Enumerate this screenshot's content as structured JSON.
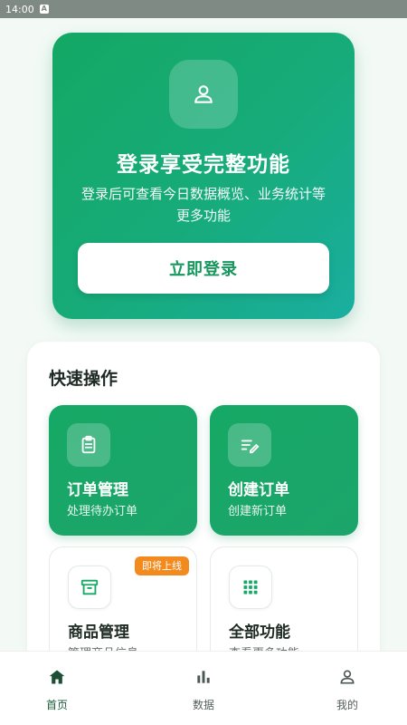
{
  "status_bar": {
    "time": "14:00",
    "badge": "A"
  },
  "login_card": {
    "title": "登录享受完整功能",
    "description": "登录后可查看今日数据概览、业务统计等更多功能",
    "button_label": "立即登录",
    "icon": "person-icon"
  },
  "quick_actions": {
    "title": "快速操作",
    "tiles": [
      {
        "title": "订单管理",
        "subtitle": "处理待办订单",
        "icon": "clipboard-icon",
        "style": "green"
      },
      {
        "title": "创建订单",
        "subtitle": "创建新订单",
        "icon": "edit-list-icon",
        "style": "green"
      },
      {
        "title": "商品管理",
        "subtitle": "管理商品信息",
        "icon": "archive-box-icon",
        "style": "light",
        "badge": "即将上线"
      },
      {
        "title": "全部功能",
        "subtitle": "查看更多功能",
        "icon": "grid-icon",
        "style": "light"
      }
    ]
  },
  "bottom_nav": {
    "items": [
      {
        "label": "首页",
        "icon": "home-icon",
        "active": true
      },
      {
        "label": "数据",
        "icon": "bar-chart-icon",
        "active": false
      },
      {
        "label": "我的",
        "icon": "person-icon",
        "active": false
      }
    ]
  },
  "colors": {
    "brand_green": "#16a865",
    "brand_teal": "#1aaea0",
    "badge_orange": "#f28a1e",
    "nav_active": "#1d5c3c"
  }
}
